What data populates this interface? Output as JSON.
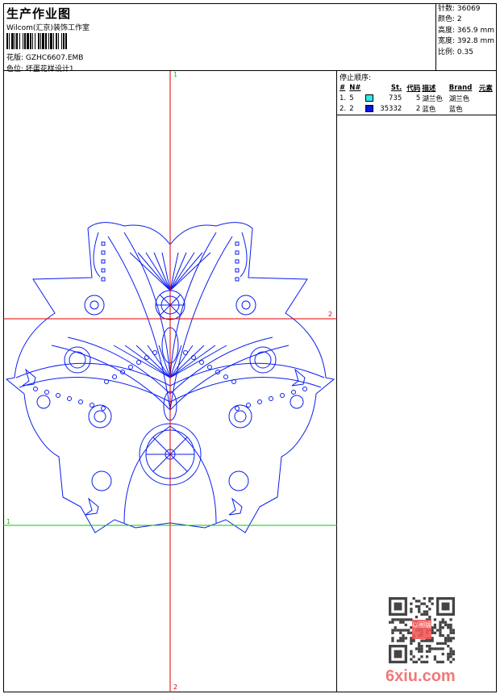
{
  "header": {
    "title": "生产作业图",
    "studio": "Wilcom(汇京)装饰工作室",
    "design_file": "花版: GZHC6607.EMB",
    "colorway": "色位: 坏蛋花样设计1"
  },
  "info": {
    "stitches": "针数: 36069",
    "colors": "颜色: 2",
    "height": "高度: 365.9 mm",
    "width": "宽度: 392.8 mm",
    "scale": "比例: 0.35"
  },
  "stop_sequence": {
    "title": "停止顺序:",
    "columns": [
      "#",
      "N#",
      "St.",
      "代码",
      "描述",
      "Brand",
      "元素"
    ],
    "rows": [
      {
        "idx": "1.",
        "n": "5",
        "color": "#33e6e6",
        "st": "735",
        "code": "5",
        "desc": "湖兰色",
        "brand": "湖兰色"
      },
      {
        "idx": "2.",
        "n": "2",
        "color": "#0a14e6",
        "st": "35332",
        "code": "2",
        "desc": "蓝色",
        "brand": "蓝色"
      }
    ]
  },
  "guides": {
    "top": "1",
    "right": "2",
    "left": "1",
    "bottom": "2"
  },
  "colors": {
    "stitch": "#0a1ef0",
    "guide_red": "#e00000",
    "guide_green": "#00cc00"
  },
  "watermark": {
    "site": "6xiu.com",
    "seal": "以图版"
  }
}
